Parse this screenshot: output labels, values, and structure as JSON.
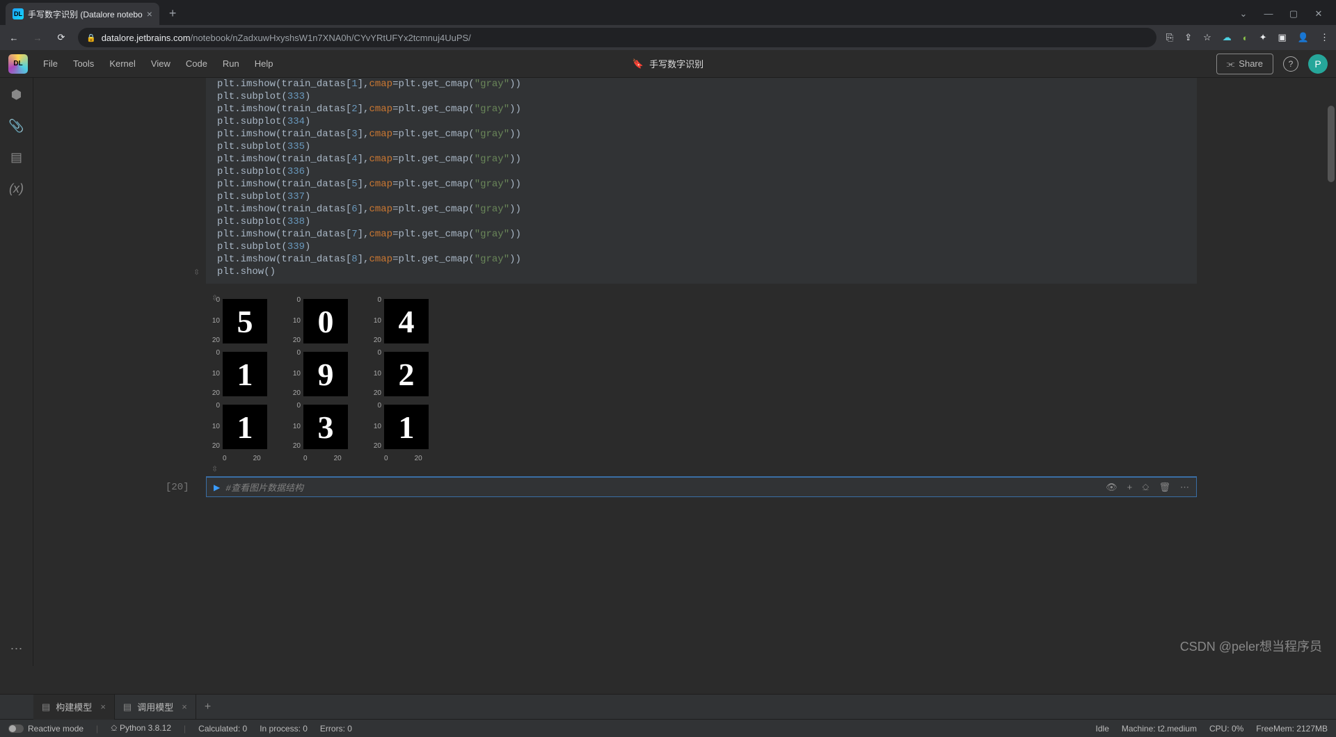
{
  "browser": {
    "tab_title": "手写数字识别 (Datalore notebo",
    "url_host": "datalore.jetbrains.com",
    "url_path": "/notebook/nZadxuwHxyshsW1n7XNA0h/CYvYRtUFYx2tcmnuj4UuPS/"
  },
  "app": {
    "menus": [
      "File",
      "Tools",
      "Kernel",
      "View",
      "Code",
      "Run",
      "Help"
    ],
    "title": "手写数字识别",
    "share": "Share",
    "avatar": "P"
  },
  "code": {
    "lines": [
      [
        "plt.imshow(train_datas[",
        "1",
        "],",
        "cmap",
        "=plt.get_cmap(",
        "\"gray\"",
        "))"
      ],
      [
        "plt.subplot(",
        "333",
        ")"
      ],
      [
        "plt.imshow(train_datas[",
        "2",
        "],",
        "cmap",
        "=plt.get_cmap(",
        "\"gray\"",
        "))"
      ],
      [
        "plt.subplot(",
        "334",
        ")"
      ],
      [
        "plt.imshow(train_datas[",
        "3",
        "],",
        "cmap",
        "=plt.get_cmap(",
        "\"gray\"",
        "))"
      ],
      [
        "plt.subplot(",
        "335",
        ")"
      ],
      [
        "plt.imshow(train_datas[",
        "4",
        "],",
        "cmap",
        "=plt.get_cmap(",
        "\"gray\"",
        "))"
      ],
      [
        "plt.subplot(",
        "336",
        ")"
      ],
      [
        "plt.imshow(train_datas[",
        "5",
        "],",
        "cmap",
        "=plt.get_cmap(",
        "\"gray\"",
        "))"
      ],
      [
        "plt.subplot(",
        "337",
        ")"
      ],
      [
        "plt.imshow(train_datas[",
        "6",
        "],",
        "cmap",
        "=plt.get_cmap(",
        "\"gray\"",
        "))"
      ],
      [
        "plt.subplot(",
        "338",
        ")"
      ],
      [
        "plt.imshow(train_datas[",
        "7",
        "],",
        "cmap",
        "=plt.get_cmap(",
        "\"gray\"",
        "))"
      ],
      [
        "plt.subplot(",
        "339",
        ")"
      ],
      [
        "plt.imshow(train_datas[",
        "8",
        "],",
        "cmap",
        "=plt.get_cmap(",
        "\"gray\"",
        "))"
      ],
      [
        "plt.show()"
      ]
    ]
  },
  "chart_data": {
    "type": "heatmap",
    "grid": [
      3,
      3
    ],
    "y_ticks": [
      0,
      10,
      20
    ],
    "x_ticks": [
      0,
      20
    ],
    "digits": [
      "5",
      "0",
      "4",
      "1",
      "9",
      "2",
      "1",
      "3",
      "1"
    ]
  },
  "next_cell": {
    "prompt": "[20]",
    "comment": "#查看图片数据结构"
  },
  "sheets": {
    "active": "构建模型",
    "inactive": "调用模型"
  },
  "status": {
    "reactive": "Reactive mode",
    "python": "Python 3.8.12",
    "calculated": "Calculated: 0",
    "inprocess": "In process: 0",
    "errors": "Errors: 0",
    "idle": "Idle",
    "machine": "Machine: t2.medium",
    "cpu": "CPU: 0%",
    "mem": "FreeMem: 2127MB"
  },
  "watermark": "CSDN @peler想当程序员"
}
